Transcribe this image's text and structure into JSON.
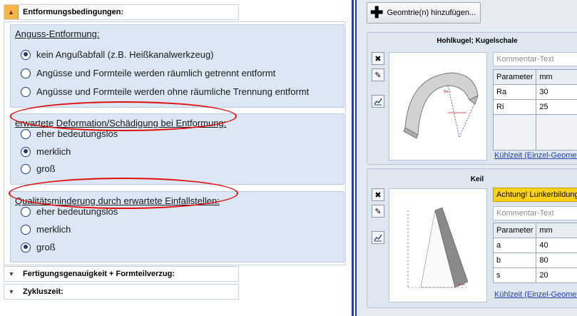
{
  "left": {
    "top_section": {
      "label": "Entformungsbedingungen:"
    },
    "groups": [
      {
        "title": "Anguss-Entformung:",
        "options": [
          {
            "label": "kein Angußabfall (z.B. Heißkanalwerkzeug)",
            "selected": true
          },
          {
            "label": "Angüsse und Formteile werden räumlich getrennt entformt",
            "selected": false
          },
          {
            "label": "Angüsse und Formteile werden ohne räumliche Trennung entformt",
            "selected": false
          }
        ]
      },
      {
        "title": "erwartete Deformation/Schädigung bei Entformung:",
        "options": [
          {
            "label": "eher bedeutungslos",
            "selected": false
          },
          {
            "label": "merklich",
            "selected": true
          },
          {
            "label": "groß",
            "selected": false
          }
        ]
      },
      {
        "title": "Qualitätsminderung durch erwartete Einfallstellen:",
        "options": [
          {
            "label": "eher bedeutungslos",
            "selected": false
          },
          {
            "label": "merklich",
            "selected": false
          },
          {
            "label": "groß",
            "selected": true
          }
        ]
      }
    ],
    "collapsed_sections": [
      {
        "label": "Fertigungsgenauigkeit + Formteilverzug:"
      },
      {
        "label": "Zykluszeit:"
      }
    ],
    "annotation_color": "#e01010"
  },
  "right": {
    "add_button": "Geomtrie(n) hinzufügen...",
    "cards": [
      {
        "title": "Hohlkugel; Kugelschale",
        "comment_placeholder": "Kommentar-Text",
        "param_header": "Parameter",
        "unit_header": "mm",
        "rows": [
          {
            "name": "Ra",
            "value": "30"
          },
          {
            "name": "Ri",
            "value": "25"
          }
        ],
        "link": "Kühlzeit (Einzel-Geometrie)"
      },
      {
        "title": "Keil",
        "warning": "Achtung! Lunkerbildung",
        "comment_placeholder": "Kommentar-Text",
        "param_header": "Parameter",
        "unit_header": "mm",
        "rows": [
          {
            "name": "a",
            "value": "40"
          },
          {
            "name": "b",
            "value": "80"
          },
          {
            "name": "s",
            "value": "20"
          }
        ],
        "link": "Kühlzeit (Einzel-Geometrie)"
      }
    ],
    "icons": [
      "close-icon",
      "edit-pencil-icon",
      "chart-icon"
    ],
    "warning_color": "#ffd21a"
  }
}
